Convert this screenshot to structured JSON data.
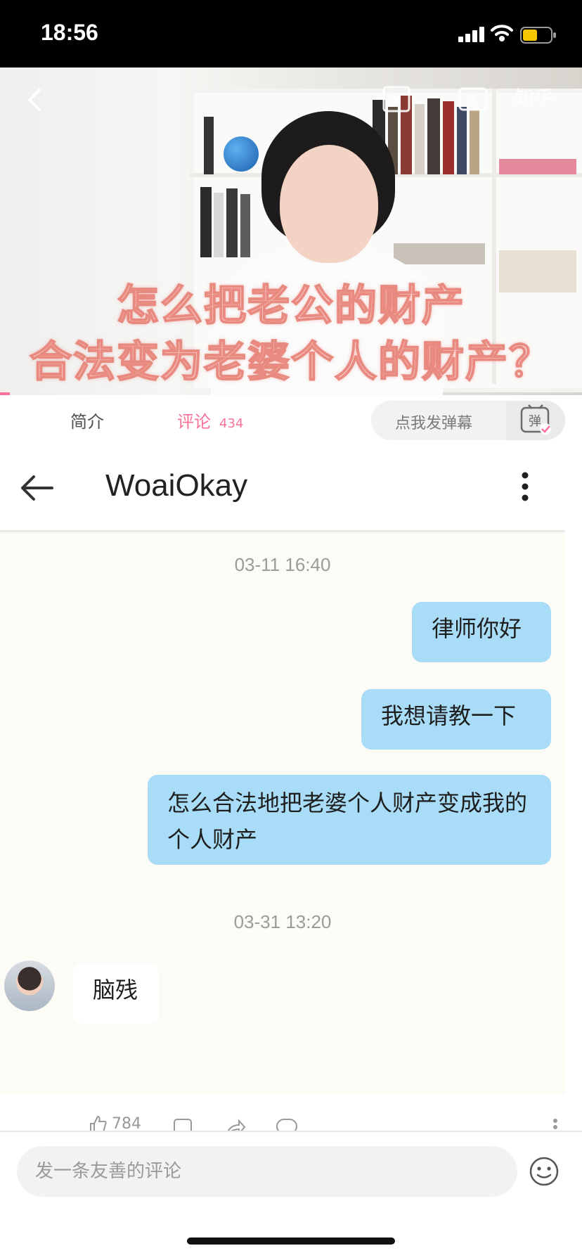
{
  "status_bar": {
    "time": "18:56"
  },
  "video": {
    "watermark": "知乎",
    "caption_line1": "怎么把老公的财产",
    "caption_line2": "合法变为老婆个人的财产？"
  },
  "tabs": {
    "intro_label": "简介",
    "comments_label": "评论",
    "comments_count": "434",
    "danmaku_placeholder": "点我发弹幕",
    "danmaku_toggle_label": "弹"
  },
  "chat": {
    "contact_name": "WoaiOkay",
    "timestamp1": "03-11 16:40",
    "messages_sent": [
      "律师你好",
      "我想请教一下",
      "怎么合法地把老婆个人财产变成我的个人财产"
    ],
    "timestamp2": "03-31 13:20",
    "reply": "脑残"
  },
  "actions": {
    "like_count": "784"
  },
  "comment_box": {
    "placeholder": "发一条友善的评论"
  },
  "colors": {
    "accent": "#fb7299",
    "bubble_sent": "#a9dcf7",
    "chat_bg": "#fdfbf5"
  }
}
